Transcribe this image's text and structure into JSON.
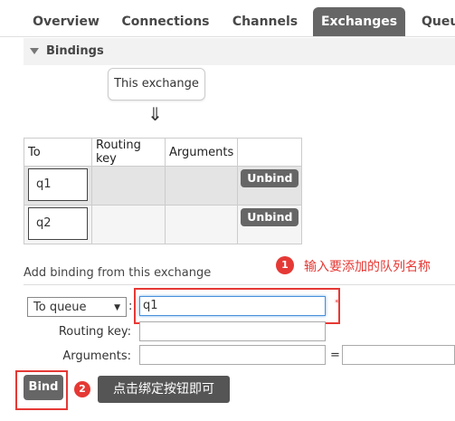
{
  "tabs": [
    {
      "label": "Overview"
    },
    {
      "label": "Connections"
    },
    {
      "label": "Channels"
    },
    {
      "label": "Exchanges"
    },
    {
      "label": "Queu"
    }
  ],
  "bindings": {
    "title": "Bindings",
    "this_exchange": "This exchange",
    "arrow": "⇓",
    "columns": [
      "To",
      "Routing key",
      "Arguments",
      ""
    ],
    "rows": [
      {
        "to": "q1",
        "routing_key": "",
        "arguments": "",
        "action": "Unbind"
      },
      {
        "to": "q2",
        "routing_key": "",
        "arguments": "",
        "action": "Unbind"
      }
    ]
  },
  "add_binding": {
    "title": "Add binding from this exchange",
    "destination_type": "To queue",
    "destination_value": "q1",
    "required_mark": "*",
    "routing_key_label": "Routing key:",
    "arguments_label": "Arguments:",
    "equals": "=",
    "bind_label": "Bind"
  },
  "annotations": {
    "step1_num": "1",
    "step1_text": "输入要添加的队列名称",
    "step2_num": "2",
    "step2_text": "点击绑定按钮即可",
    "accent_color": "#e53935"
  }
}
